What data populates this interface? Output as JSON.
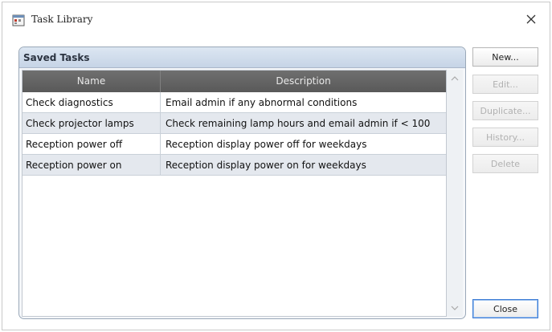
{
  "window": {
    "title": "Task Library",
    "close_glyph": "✕"
  },
  "group": {
    "title": "Saved Tasks"
  },
  "table": {
    "columns": [
      "Name",
      "Description"
    ],
    "rows": [
      {
        "name": "Check diagnostics",
        "description": "Email admin if any abnormal conditions"
      },
      {
        "name": "Check projector lamps",
        "description": "Check remaining lamp hours and email admin if < 100"
      },
      {
        "name": "Reception power off",
        "description": "Reception display power off for weekdays"
      },
      {
        "name": "Reception power on",
        "description": "Reception display power on for weekdays"
      }
    ]
  },
  "buttons": {
    "new": "New...",
    "edit": "Edit...",
    "duplicate": "Duplicate...",
    "history": "History...",
    "delete": "Delete",
    "close": "Close"
  },
  "icons": {
    "app": "calendar-task-icon",
    "close": "close-icon"
  },
  "colors": {
    "header_dark": "#595959",
    "group_header": "#c6d4e6",
    "row_alt": "#e4e8ee",
    "default_button_border": "#3a7bd5"
  }
}
